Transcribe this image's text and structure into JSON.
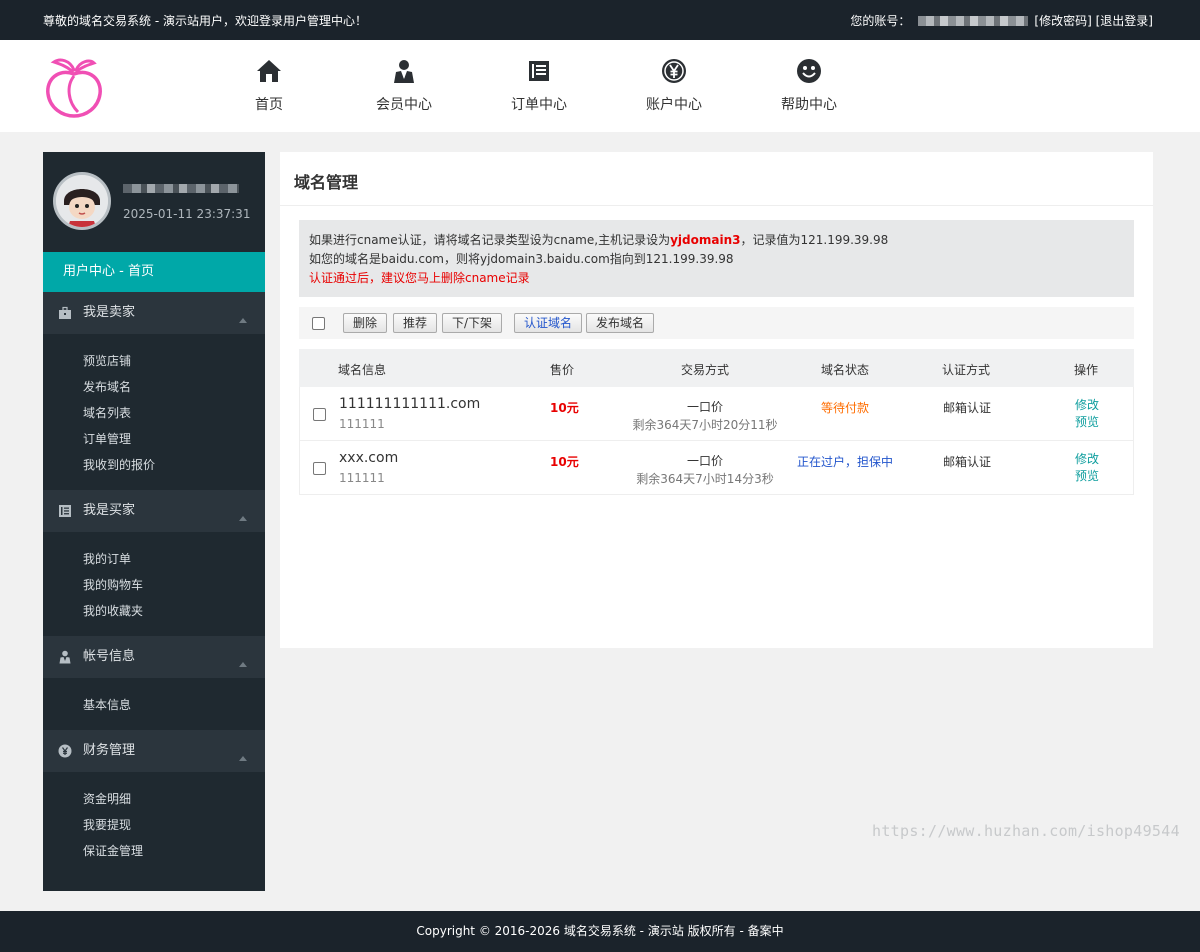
{
  "topbar": {
    "welcome": "尊敬的域名交易系统 - 演示站用户，欢迎登录用户管理中心！",
    "account_label": "您的账号：",
    "change_password": "[修改密码]",
    "logout": "[退出登录]"
  },
  "nav": [
    {
      "label": "首页",
      "icon": "home-icon"
    },
    {
      "label": "会员中心",
      "icon": "user-suit-icon"
    },
    {
      "label": "订单中心",
      "icon": "ledger-icon"
    },
    {
      "label": "账户中心",
      "icon": "yen-coin-icon"
    },
    {
      "label": "帮助中心",
      "icon": "smiley-icon"
    }
  ],
  "sidebar": {
    "time": "2025-01-11 23:37:31",
    "home": "用户中心 - 首页",
    "groups": [
      {
        "title": "我是卖家",
        "icon": "briefcase-icon",
        "items": [
          "预览店铺",
          "发布域名",
          "域名列表",
          "订单管理",
          "我收到的报价"
        ]
      },
      {
        "title": "我是买家",
        "icon": "ledger-icon",
        "items": [
          "我的订单",
          "我的购物车",
          "我的收藏夹"
        ]
      },
      {
        "title": "帐号信息",
        "icon": "user-suit-icon",
        "items": [
          "基本信息"
        ]
      },
      {
        "title": "财务管理",
        "icon": "yen-coin-icon",
        "items": [
          "资金明细",
          "我要提现",
          "保证金管理"
        ]
      }
    ]
  },
  "main": {
    "title": "域名管理",
    "notice": {
      "line1_pre": "如果进行cname认证，请将域名记录类型设为cname,主机记录设为",
      "line1_hl": "yjdomain3",
      "line1_post": "，记录值为121.199.39.98",
      "line2": "如您的域名是baidu.com，则将yjdomain3.baidu.com指向到121.199.39.98",
      "line3": "认证通过后，建议您马上删除cname记录"
    },
    "toolbar": {
      "delete": "删除",
      "recommend": "推荐",
      "shelf": "下/下架",
      "verify": "认证域名",
      "publish": "发布域名"
    },
    "table": {
      "headers": {
        "info": "域名信息",
        "price": "售价",
        "mode": "交易方式",
        "status": "域名状态",
        "verify": "认证方式",
        "ops": "操作"
      },
      "rows": [
        {
          "domain": "111111111111.com",
          "sub": "111111",
          "price": "10元",
          "mode": "一口价",
          "remain": "剩余364天7小时20分11秒",
          "status": "等待付款",
          "status_color": "#ff6d00",
          "verify": "邮箱认证",
          "edit": "修改",
          "preview": "预览"
        },
        {
          "domain": "xxx.com",
          "sub": "111111",
          "price": "10元",
          "mode": "一口价",
          "remain": "剩余364天7小时14分3秒",
          "status": "正在过户，担保中",
          "status_color": "#2255cc",
          "verify": "邮箱认证",
          "edit": "修改",
          "preview": "预览"
        }
      ]
    }
  },
  "watermark": "https://www.huzhan.com/ishop49544",
  "footer": "Copyright © 2016-2026 域名交易系统 - 演示站 版权所有 - 备案中"
}
